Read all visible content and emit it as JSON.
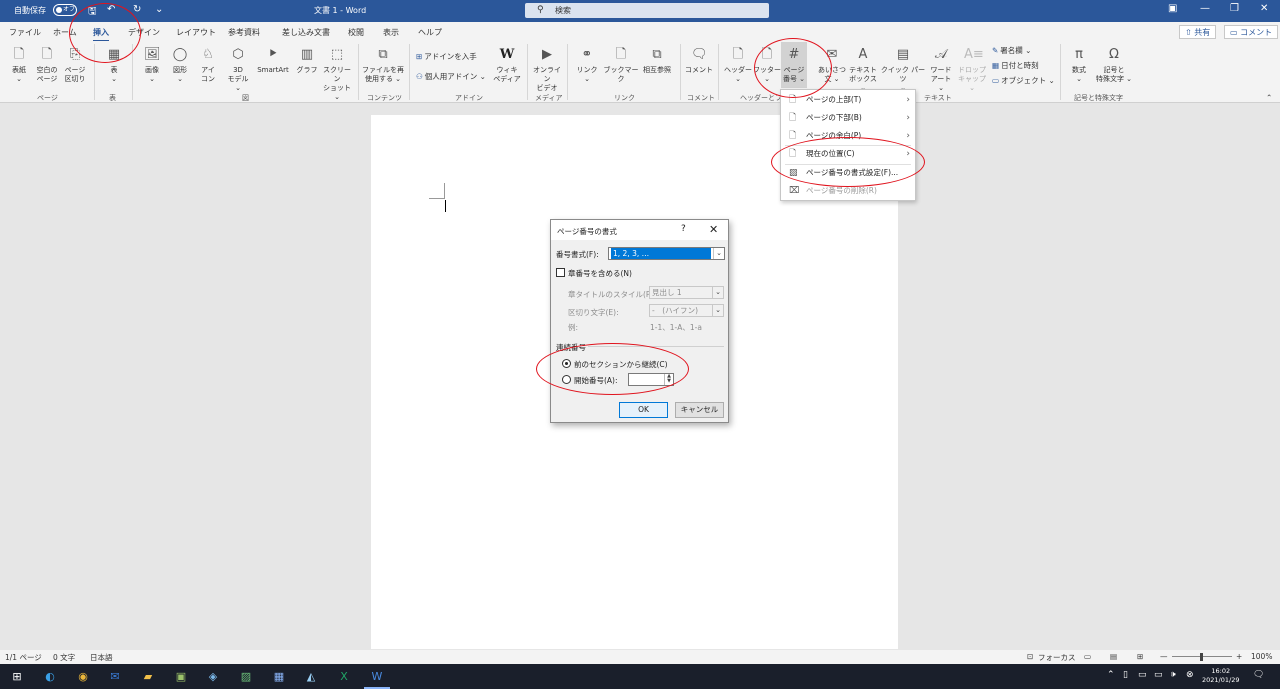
{
  "titlebar": {
    "autosave_label": "自動保存",
    "autosave_state": "オフ",
    "doc_title": "文書 1  -  Word",
    "search_placeholder": "検索"
  },
  "tabs": [
    "ファイル",
    "ホーム",
    "挿入",
    "デザイン",
    "レイアウト",
    "参考資料",
    "差し込み文書",
    "校閲",
    "表示",
    "ヘルプ"
  ],
  "active_tab": "挿入",
  "share_label": "共有",
  "comment_label": "コメント",
  "ribbon": {
    "buttons": {
      "cover": "表紙",
      "blank1": "空白の",
      "blank2": "ページ",
      "pagebreak1": "ページ",
      "pagebreak2": "区切り",
      "table": "表",
      "picture": "画像",
      "shape": "図形",
      "icon1": "アイ",
      "icon2": "コン",
      "model1": "3D",
      "model2": "モデル",
      "smartart": "SmartArt",
      "chart": "グラフ",
      "screenshot1": "スクリーン",
      "screenshot2": "ショット",
      "reuse1": "ファイルを再",
      "reuse2": "使用する",
      "addin_get": "アドインを入手",
      "addin_my": "個人用アドイン",
      "wiki1": "ウィキ",
      "wiki2": "ペディア",
      "video1": "オンライン",
      "video2": "ビデオ",
      "link": "リンク",
      "bookmark": "ブックマーク",
      "crossref": "相互参照",
      "comment": "コメント",
      "header": "ヘッダー",
      "footer": "フッター",
      "pagenum1": "ページ",
      "pagenum2": "番号",
      "greet1": "あいさつ",
      "greet2": "文",
      "textbox1": "テキスト",
      "textbox2": "ボックス",
      "quick": "クイック パーツ",
      "wordart1": "ワード",
      "wordart2": "アート",
      "dropcap1": "ドロップ",
      "dropcap2": "キャップ",
      "sigline": "署名欄",
      "datetime": "日付と時刻",
      "object": "オブジェクト",
      "equation": "数式",
      "symbol1": "記号と",
      "symbol2": "特殊文字"
    },
    "groups": {
      "pages": "ページ",
      "tables": "表",
      "illustrations": "図",
      "content": "コンテンツ",
      "addins": "アドイン",
      "media": "メディア",
      "links": "リンク",
      "comments": "コメント",
      "headerfooter": "ヘッダーとフッ",
      "text": "テキスト",
      "symbols": "記号と特殊文字"
    }
  },
  "page_number_menu": {
    "items": [
      {
        "label": "ページの上部(T)",
        "submenu": true
      },
      {
        "label": "ページの下部(B)",
        "submenu": true
      },
      {
        "label": "ページの余白(P)",
        "submenu": true
      },
      {
        "label": "現在の位置(C)",
        "submenu": true
      },
      {
        "label": "ページ番号の書式設定(F)...",
        "submenu": false
      },
      {
        "label": "ページ番号の削除(R)",
        "submenu": false
      }
    ]
  },
  "dialog": {
    "title": "ページ番号の書式",
    "help": "?",
    "format_label": "番号書式(F):",
    "format_value": "1, 2, 3, …",
    "include_chapter_label": "章番号を含める(N)",
    "chapter_style_label": "章タイトルのスタイル(P):",
    "chapter_style_value": "見出し 1",
    "separator_label": "区切り文字(E):",
    "separator_value": "-　(ハイフン)",
    "example_label": "例:",
    "example_value": "1-1、1-A、1-a",
    "numbering_group": "連続番号",
    "continue_label": "前のセクションから継続(C)",
    "start_at_label": "開始番号(A):",
    "start_at_value": "",
    "ok_label": "OK",
    "cancel_label": "キャンセル"
  },
  "statusbar": {
    "page": "1/1 ページ",
    "words": "0 文字",
    "language": "日本語",
    "focus": "フォーカス",
    "zoom": "100%"
  },
  "taskbar": {
    "time": "16:02",
    "date": "2021/01/29"
  },
  "colors": {
    "accent": "#2b579a",
    "annotation": "#e0141e"
  }
}
